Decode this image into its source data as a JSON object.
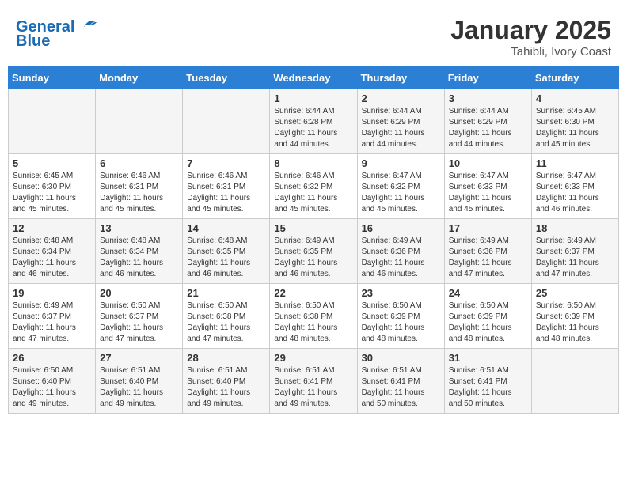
{
  "header": {
    "logo_line1": "General",
    "logo_line2": "Blue",
    "month": "January 2025",
    "location": "Tahibli, Ivory Coast"
  },
  "weekdays": [
    "Sunday",
    "Monday",
    "Tuesday",
    "Wednesday",
    "Thursday",
    "Friday",
    "Saturday"
  ],
  "weeks": [
    [
      {
        "day": "",
        "sunrise": "",
        "sunset": "",
        "daylight": ""
      },
      {
        "day": "",
        "sunrise": "",
        "sunset": "",
        "daylight": ""
      },
      {
        "day": "",
        "sunrise": "",
        "sunset": "",
        "daylight": ""
      },
      {
        "day": "1",
        "sunrise": "Sunrise: 6:44 AM",
        "sunset": "Sunset: 6:28 PM",
        "daylight": "Daylight: 11 hours and 44 minutes."
      },
      {
        "day": "2",
        "sunrise": "Sunrise: 6:44 AM",
        "sunset": "Sunset: 6:29 PM",
        "daylight": "Daylight: 11 hours and 44 minutes."
      },
      {
        "day": "3",
        "sunrise": "Sunrise: 6:44 AM",
        "sunset": "Sunset: 6:29 PM",
        "daylight": "Daylight: 11 hours and 44 minutes."
      },
      {
        "day": "4",
        "sunrise": "Sunrise: 6:45 AM",
        "sunset": "Sunset: 6:30 PM",
        "daylight": "Daylight: 11 hours and 45 minutes."
      }
    ],
    [
      {
        "day": "5",
        "sunrise": "Sunrise: 6:45 AM",
        "sunset": "Sunset: 6:30 PM",
        "daylight": "Daylight: 11 hours and 45 minutes."
      },
      {
        "day": "6",
        "sunrise": "Sunrise: 6:46 AM",
        "sunset": "Sunset: 6:31 PM",
        "daylight": "Daylight: 11 hours and 45 minutes."
      },
      {
        "day": "7",
        "sunrise": "Sunrise: 6:46 AM",
        "sunset": "Sunset: 6:31 PM",
        "daylight": "Daylight: 11 hours and 45 minutes."
      },
      {
        "day": "8",
        "sunrise": "Sunrise: 6:46 AM",
        "sunset": "Sunset: 6:32 PM",
        "daylight": "Daylight: 11 hours and 45 minutes."
      },
      {
        "day": "9",
        "sunrise": "Sunrise: 6:47 AM",
        "sunset": "Sunset: 6:32 PM",
        "daylight": "Daylight: 11 hours and 45 minutes."
      },
      {
        "day": "10",
        "sunrise": "Sunrise: 6:47 AM",
        "sunset": "Sunset: 6:33 PM",
        "daylight": "Daylight: 11 hours and 45 minutes."
      },
      {
        "day": "11",
        "sunrise": "Sunrise: 6:47 AM",
        "sunset": "Sunset: 6:33 PM",
        "daylight": "Daylight: 11 hours and 46 minutes."
      }
    ],
    [
      {
        "day": "12",
        "sunrise": "Sunrise: 6:48 AM",
        "sunset": "Sunset: 6:34 PM",
        "daylight": "Daylight: 11 hours and 46 minutes."
      },
      {
        "day": "13",
        "sunrise": "Sunrise: 6:48 AM",
        "sunset": "Sunset: 6:34 PM",
        "daylight": "Daylight: 11 hours and 46 minutes."
      },
      {
        "day": "14",
        "sunrise": "Sunrise: 6:48 AM",
        "sunset": "Sunset: 6:35 PM",
        "daylight": "Daylight: 11 hours and 46 minutes."
      },
      {
        "day": "15",
        "sunrise": "Sunrise: 6:49 AM",
        "sunset": "Sunset: 6:35 PM",
        "daylight": "Daylight: 11 hours and 46 minutes."
      },
      {
        "day": "16",
        "sunrise": "Sunrise: 6:49 AM",
        "sunset": "Sunset: 6:36 PM",
        "daylight": "Daylight: 11 hours and 46 minutes."
      },
      {
        "day": "17",
        "sunrise": "Sunrise: 6:49 AM",
        "sunset": "Sunset: 6:36 PM",
        "daylight": "Daylight: 11 hours and 47 minutes."
      },
      {
        "day": "18",
        "sunrise": "Sunrise: 6:49 AM",
        "sunset": "Sunset: 6:37 PM",
        "daylight": "Daylight: 11 hours and 47 minutes."
      }
    ],
    [
      {
        "day": "19",
        "sunrise": "Sunrise: 6:49 AM",
        "sunset": "Sunset: 6:37 PM",
        "daylight": "Daylight: 11 hours and 47 minutes."
      },
      {
        "day": "20",
        "sunrise": "Sunrise: 6:50 AM",
        "sunset": "Sunset: 6:37 PM",
        "daylight": "Daylight: 11 hours and 47 minutes."
      },
      {
        "day": "21",
        "sunrise": "Sunrise: 6:50 AM",
        "sunset": "Sunset: 6:38 PM",
        "daylight": "Daylight: 11 hours and 47 minutes."
      },
      {
        "day": "22",
        "sunrise": "Sunrise: 6:50 AM",
        "sunset": "Sunset: 6:38 PM",
        "daylight": "Daylight: 11 hours and 48 minutes."
      },
      {
        "day": "23",
        "sunrise": "Sunrise: 6:50 AM",
        "sunset": "Sunset: 6:39 PM",
        "daylight": "Daylight: 11 hours and 48 minutes."
      },
      {
        "day": "24",
        "sunrise": "Sunrise: 6:50 AM",
        "sunset": "Sunset: 6:39 PM",
        "daylight": "Daylight: 11 hours and 48 minutes."
      },
      {
        "day": "25",
        "sunrise": "Sunrise: 6:50 AM",
        "sunset": "Sunset: 6:39 PM",
        "daylight": "Daylight: 11 hours and 48 minutes."
      }
    ],
    [
      {
        "day": "26",
        "sunrise": "Sunrise: 6:50 AM",
        "sunset": "Sunset: 6:40 PM",
        "daylight": "Daylight: 11 hours and 49 minutes."
      },
      {
        "day": "27",
        "sunrise": "Sunrise: 6:51 AM",
        "sunset": "Sunset: 6:40 PM",
        "daylight": "Daylight: 11 hours and 49 minutes."
      },
      {
        "day": "28",
        "sunrise": "Sunrise: 6:51 AM",
        "sunset": "Sunset: 6:40 PM",
        "daylight": "Daylight: 11 hours and 49 minutes."
      },
      {
        "day": "29",
        "sunrise": "Sunrise: 6:51 AM",
        "sunset": "Sunset: 6:41 PM",
        "daylight": "Daylight: 11 hours and 49 minutes."
      },
      {
        "day": "30",
        "sunrise": "Sunrise: 6:51 AM",
        "sunset": "Sunset: 6:41 PM",
        "daylight": "Daylight: 11 hours and 50 minutes."
      },
      {
        "day": "31",
        "sunrise": "Sunrise: 6:51 AM",
        "sunset": "Sunset: 6:41 PM",
        "daylight": "Daylight: 11 hours and 50 minutes."
      },
      {
        "day": "",
        "sunrise": "",
        "sunset": "",
        "daylight": ""
      }
    ]
  ]
}
